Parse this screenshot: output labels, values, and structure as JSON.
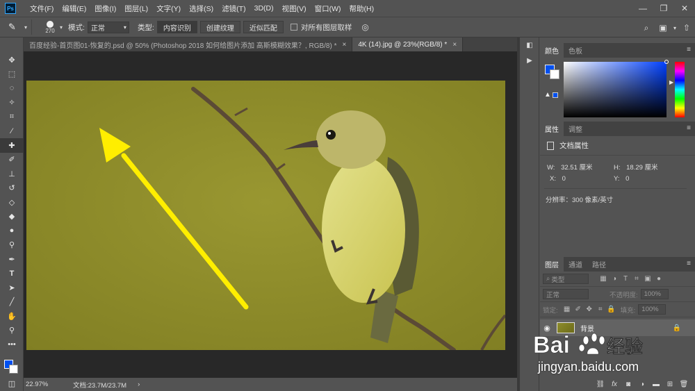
{
  "app": {
    "logo": "Ps"
  },
  "menu": [
    "文件(F)",
    "编辑(E)",
    "图像(I)",
    "图层(L)",
    "文字(Y)",
    "选择(S)",
    "滤镜(T)",
    "3D(D)",
    "视图(V)",
    "窗口(W)",
    "帮助(H)"
  ],
  "options": {
    "brush_size": "270",
    "mode_label": "模式:",
    "mode_value": "正常",
    "type_label": "类型:",
    "type_buttons": [
      "内容识别",
      "创建纹理",
      "近似匹配"
    ],
    "sample_all_label": "对所有图层取样"
  },
  "tabs": [
    {
      "label": "百度经验-首页图01-恢复的.psd @ 50% (Photoshop 2018  如何给图片添加 高斯模糊效果？, RGB/8) *"
    },
    {
      "label": "4K (14).jpg @ 23%(RGB/8) *"
    }
  ],
  "status": {
    "zoom": "22.97%",
    "doc": "文档:23.7M/23.7M"
  },
  "color_panel": {
    "tabs": [
      "颜色",
      "色板"
    ],
    "fg_color": "#0050f0",
    "bg_color": "#ffffff"
  },
  "props_panel": {
    "tabs": [
      "属性",
      "调整"
    ],
    "title": "文档属性",
    "w_label": "W:",
    "w_value": "32.51 厘米",
    "h_label": "H:",
    "h_value": "18.29 厘米",
    "x_label": "X:",
    "x_value": "0",
    "y_label": "Y:",
    "y_value": "0",
    "resolution": "分辨率：300 像素/英寸"
  },
  "layers_panel": {
    "tabs": [
      "图层",
      "通道",
      "路径"
    ],
    "filter_placeholder": "类型",
    "blend": "正常",
    "opacity_label": "不透明度:",
    "opacity_value": "100%",
    "lock_label": "锁定:",
    "fill_label": "填充:",
    "fill_value": "100%",
    "layer_name": "背景"
  },
  "watermark": {
    "url": "jingyan.baidu.com"
  },
  "colors": {
    "annotation_arrow": "#ffee00",
    "photo_bg": "#8e8c2a"
  }
}
